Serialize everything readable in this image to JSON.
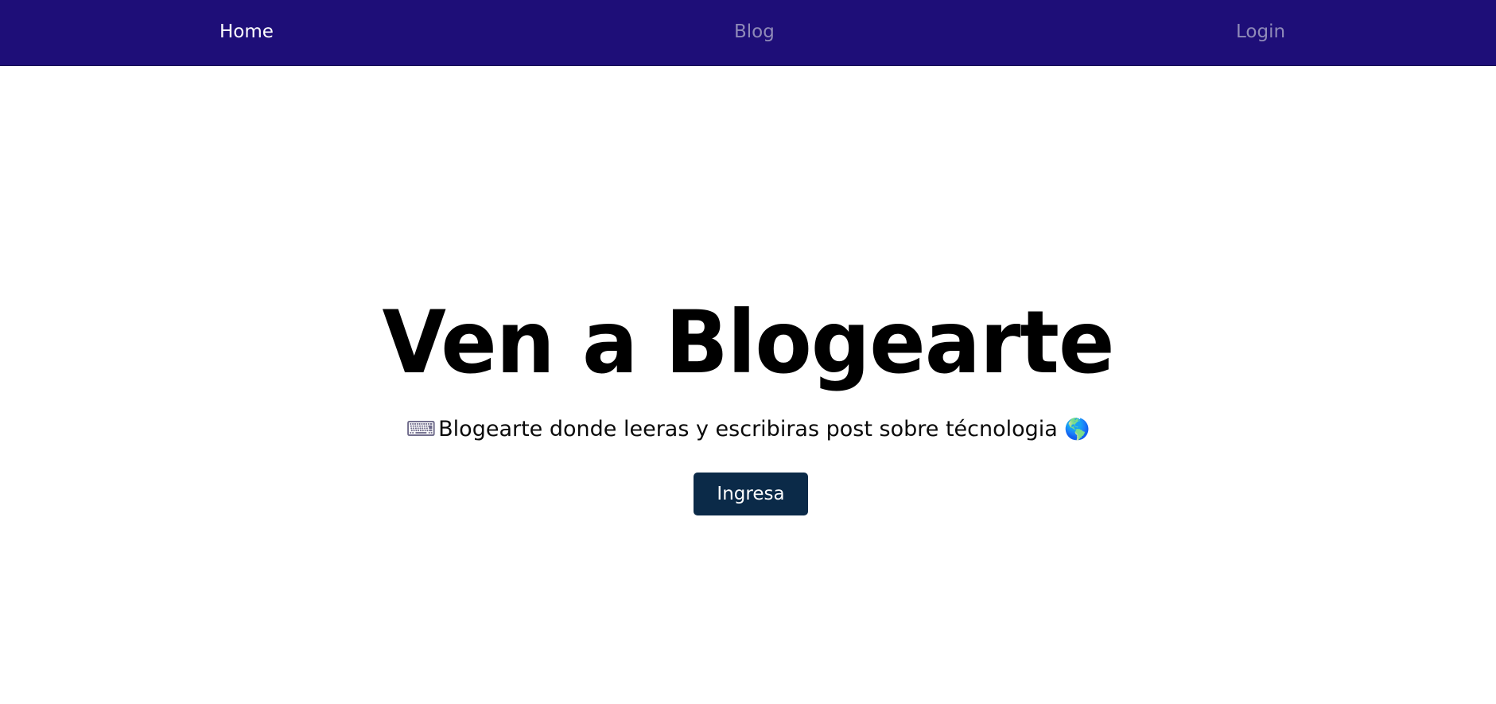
{
  "nav": {
    "home_label": "Home",
    "blog_label": "Blog",
    "login_label": "Login"
  },
  "hero": {
    "title": "Ven a Blogearte",
    "subtitle": "Blogearte donde leeras y escribiras post sobre técnologia",
    "leading_icon": "⌨",
    "trailing_icon": "🌎",
    "cta_label": "Ingresa"
  },
  "colors": {
    "navbar_bg": "#1e0e78",
    "nav_active": "#ffffff",
    "nav_inactive": "#8f8ab8",
    "button_bg": "#0b2a48"
  },
  "icons": {
    "leading": "keyboard-icon",
    "trailing": "globe-icon"
  }
}
